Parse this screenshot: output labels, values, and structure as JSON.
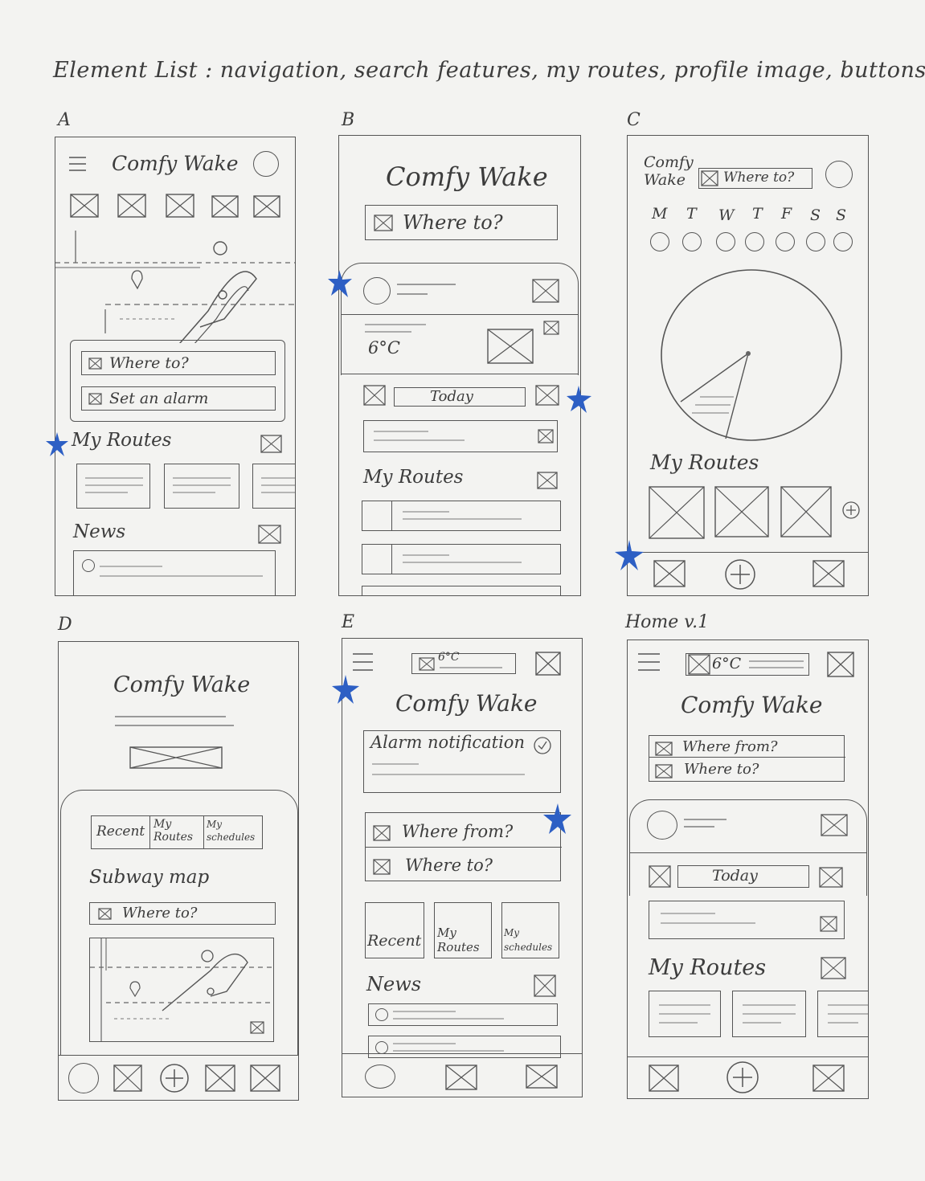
{
  "header": {
    "element_list": "Element List :  navigation, search features, my routes, profile image, buttons"
  },
  "labels": {
    "a": "A",
    "b": "B",
    "c": "C",
    "d": "D",
    "e": "E",
    "home": "Home v.1"
  },
  "app_name": "Comfy Wake",
  "app_name_split": [
    "Comfy",
    "Wake"
  ],
  "where_to": "Where to?",
  "where_from": "Where from?",
  "set_alarm": "Set an alarm",
  "my_routes": "My Routes",
  "news": "News",
  "temp": "6°C",
  "today": "Today",
  "weekdays": [
    "M",
    "T",
    "W",
    "T",
    "F",
    "S",
    "S"
  ],
  "tabs": {
    "recent": "Recent",
    "my_routes": "My Routes",
    "my_schedules": "My schedules"
  },
  "subway_map": "Subway map",
  "alarm_notification": "Alarm notification",
  "accent_color": "#2d5fc4",
  "ink_color": "#555555"
}
